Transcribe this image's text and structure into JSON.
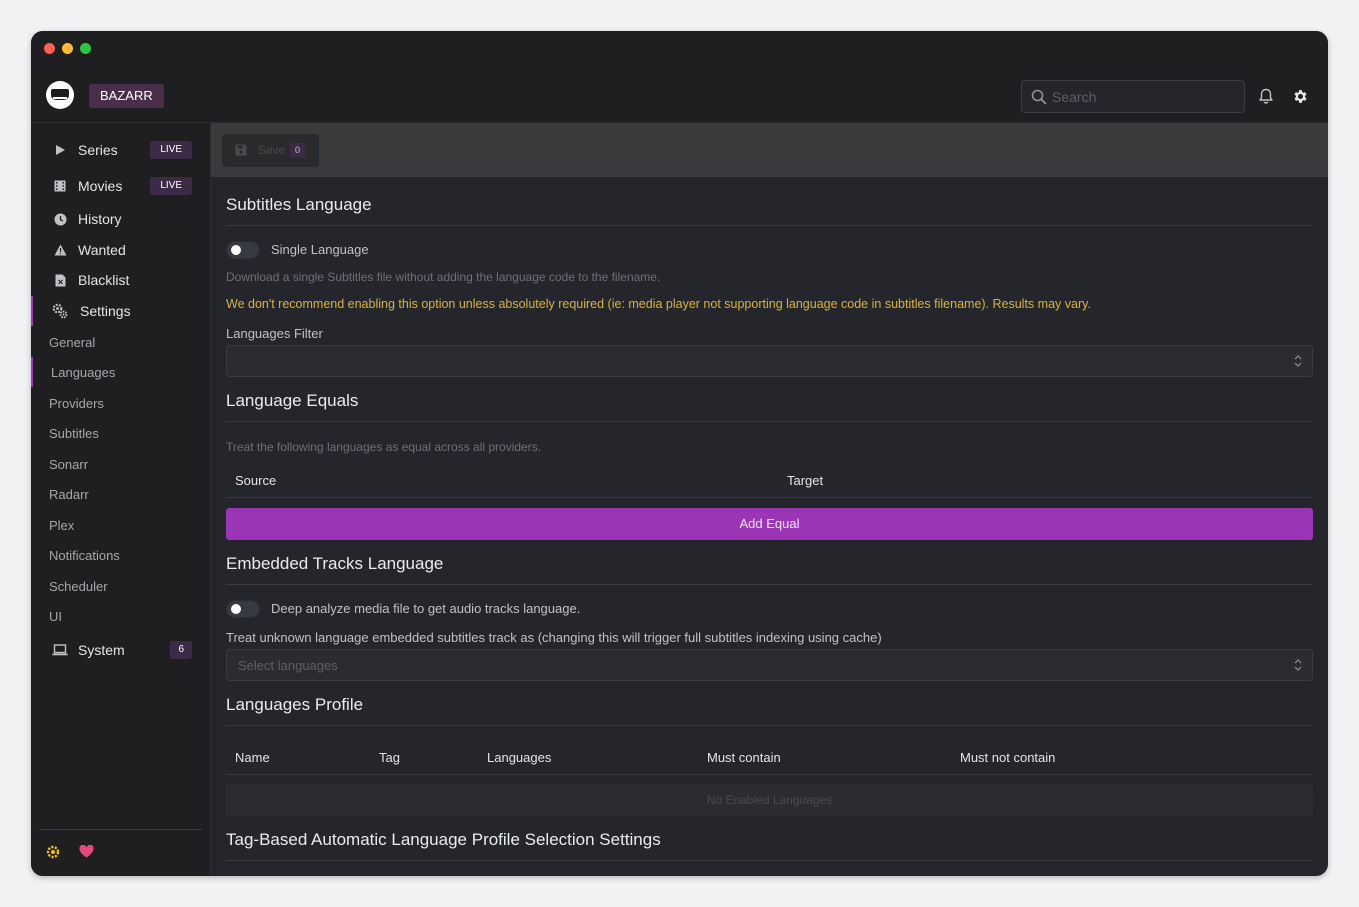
{
  "app": {
    "brand": "BAZARR"
  },
  "header": {
    "search_placeholder": "Search"
  },
  "sidebar": {
    "items": [
      {
        "label": "Series",
        "icon": "play-icon",
        "badge": "LIVE"
      },
      {
        "label": "Movies",
        "icon": "film-icon",
        "badge": "LIVE"
      },
      {
        "label": "History",
        "icon": "clock-icon"
      },
      {
        "label": "Wanted",
        "icon": "warning-icon"
      },
      {
        "label": "Blacklist",
        "icon": "file-x-icon"
      },
      {
        "label": "Settings",
        "icon": "cogs-icon"
      }
    ],
    "settings_sub": [
      "General",
      "Languages",
      "Providers",
      "Subtitles",
      "Sonarr",
      "Radarr",
      "Plex",
      "Notifications",
      "Scheduler",
      "UI"
    ],
    "system": {
      "label": "System",
      "badge": "6"
    }
  },
  "toolbar": {
    "save_label": "Save",
    "save_count": "0"
  },
  "subtitles_language": {
    "title": "Subtitles Language",
    "single_label": "Single Language",
    "single_desc": "Download a single Subtitles file without adding the language code to the filename.",
    "warning": "We don't recommend enabling this option unless absolutely required (ie: media player not supporting language code in subtitles filename). Results may vary.",
    "filter_label": "Languages Filter"
  },
  "language_equals": {
    "title": "Language Equals",
    "desc": "Treat the following languages as equal across all providers.",
    "col_source": "Source",
    "col_target": "Target",
    "add_label": "Add Equal"
  },
  "embedded": {
    "title": "Embedded Tracks Language",
    "deep_label": "Deep analyze media file to get audio tracks language.",
    "unknown_label": "Treat unknown language embedded subtitles track as (changing this will trigger full subtitles indexing using cache)",
    "select_placeholder": "Select languages"
  },
  "profiles": {
    "title": "Languages Profile",
    "columns": [
      "Name",
      "Tag",
      "Languages",
      "Must contain",
      "Must not contain"
    ],
    "empty": "No Enabled Languages"
  },
  "tag_based": {
    "title": "Tag-Based Automatic Language Profile Selection Settings"
  },
  "colors": {
    "accent": "#9b34b5",
    "warning": "#d5b53a"
  }
}
